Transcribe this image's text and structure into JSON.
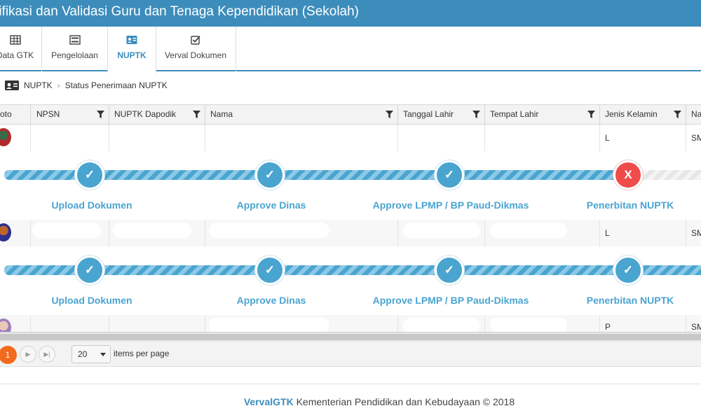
{
  "header": {
    "title": "rifikasi dan Validasi Guru dan Tenaga Kependidikan (Sekolah)"
  },
  "tabs": [
    {
      "label": "Data GTK",
      "icon": "table-icon"
    },
    {
      "label": "Pengelolaan",
      "icon": "list-icon"
    },
    {
      "label": "NUPTK",
      "icon": "id-card-icon"
    },
    {
      "label": "Verval Dokumen",
      "icon": "checkbox-icon"
    }
  ],
  "active_tab": "NUPTK",
  "breadcrumb": {
    "root": "NUPTK",
    "current": "Status Penerimaan NUPTK"
  },
  "grid": {
    "columns": [
      "oto",
      "NPSN",
      "NUPTK Dapodik",
      "Nama",
      "Tanggal Lahir",
      "Tempat Lahir",
      "Jenis Kelamin",
      "Na"
    ],
    "rows": [
      {
        "jenis_kelamin": "L",
        "na": "SM"
      },
      {
        "jenis_kelamin": "L",
        "na": "SM"
      },
      {
        "jenis_kelamin": "P",
        "na": "SM"
      }
    ],
    "progress": [
      {
        "steps": [
          {
            "label": "Upload Dokumen",
            "mark": "✓",
            "status": "done"
          },
          {
            "label": "Approve Dinas",
            "mark": "✓",
            "status": "done"
          },
          {
            "label": "Approve LPMP / BP Paud-Dikmas",
            "mark": "✓",
            "status": "done"
          },
          {
            "label": "Penerbitan NUPTK",
            "mark": "X",
            "status": "failed"
          }
        ]
      },
      {
        "steps": [
          {
            "label": "Upload Dokumen",
            "mark": "✓",
            "status": "done"
          },
          {
            "label": "Approve Dinas",
            "mark": "✓",
            "status": "done"
          },
          {
            "label": "Approve LPMP / BP Paud-Dikmas",
            "mark": "✓",
            "status": "done"
          },
          {
            "label": "Penerbitan NUPTK",
            "mark": "✓",
            "status": "done"
          }
        ]
      }
    ]
  },
  "pager": {
    "current_page": "1",
    "page_size": "20",
    "page_size_label": "items per page"
  },
  "footer": {
    "brand": "VervalGTK",
    "text": " Kementerian Pendidikan dan Kebudayaan © 2018"
  },
  "colors": {
    "primary": "#3c8dbc",
    "step_done": "#4aa4d0",
    "step_failed": "#f04b4b",
    "current_page": "#f26b1d"
  }
}
